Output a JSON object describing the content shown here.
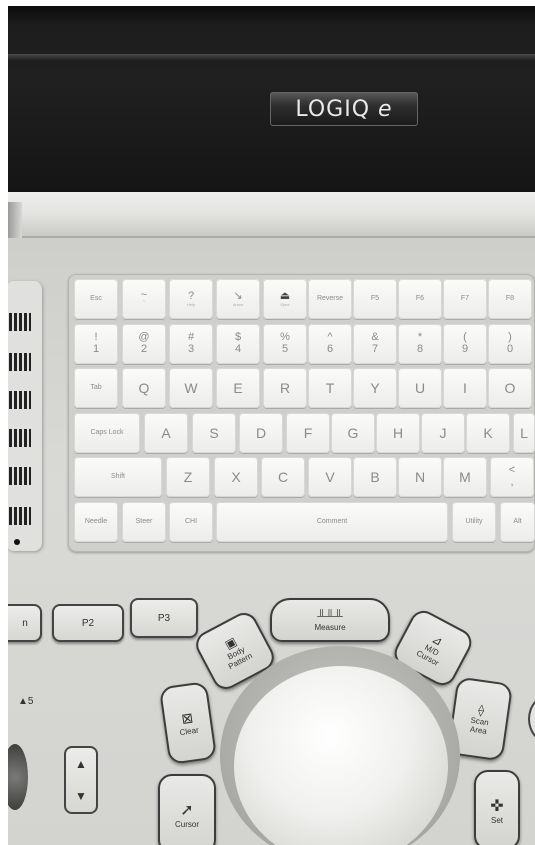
{
  "logo": {
    "brand": "LOGIQ",
    "model": "e"
  },
  "keyboard": {
    "row1": [
      {
        "top": "",
        "bottom": "Esc"
      },
      {
        "top": "~",
        "bottom": "`"
      },
      {
        "top": "?",
        "bottom": "Help"
      },
      {
        "top": "↘",
        "bottom": "Arrow"
      },
      {
        "top": "⏏",
        "bottom": "Eject"
      },
      {
        "top": "",
        "bottom": "Reverse"
      },
      {
        "top": "",
        "bottom": "F5"
      },
      {
        "top": "",
        "bottom": "F6"
      },
      {
        "top": "",
        "bottom": "F7"
      },
      {
        "top": "",
        "bottom": "F8"
      }
    ],
    "row2": [
      {
        "top": "!",
        "bottom": "1"
      },
      {
        "top": "@",
        "bottom": "2"
      },
      {
        "top": "#",
        "bottom": "3"
      },
      {
        "top": "$",
        "bottom": "4"
      },
      {
        "top": "%",
        "bottom": "5"
      },
      {
        "top": "^",
        "bottom": "6"
      },
      {
        "top": "&",
        "bottom": "7"
      },
      {
        "top": "*",
        "bottom": "8"
      },
      {
        "top": "(",
        "bottom": "9"
      },
      {
        "top": ")",
        "bottom": "0"
      }
    ],
    "row3": [
      "Tab",
      "Q",
      "W",
      "E",
      "R",
      "T",
      "Y",
      "U",
      "I",
      "O"
    ],
    "row4": [
      "Caps Lock",
      "A",
      "S",
      "D",
      "F",
      "G",
      "H",
      "J",
      "K",
      "L"
    ],
    "row5": [
      "Shift",
      "Z",
      "X",
      "C",
      "V",
      "B",
      "N",
      "M",
      "<"
    ],
    "row5_extra": ",",
    "row6": {
      "needle": "Needle",
      "steer": "Steer",
      "chi": "CHI",
      "comment": "Comment",
      "utility": "Utility",
      "alt": "Alt"
    }
  },
  "panel": {
    "p1_fragment": "n",
    "p2": "P2",
    "p3": "P3",
    "measure": "Measure",
    "body_pattern_1": "Body",
    "body_pattern_2": "Pattern",
    "md_cursor_1": "M/D",
    "md_cursor_2": "Cursor",
    "clear": "Clear",
    "scan_area_1": "Scan",
    "scan_area_2": "Area",
    "cursor": "Cursor",
    "set": "Set",
    "level_indicator": "5"
  },
  "icons": {
    "measure": "ruler-icon",
    "body_pattern": "body-pattern-icon",
    "md_cursor": "md-cursor-icon",
    "clear": "clear-icon",
    "scan_area": "scan-area-icon",
    "cursor": "cursor-arrow-icon",
    "set": "crosshair-icon"
  }
}
